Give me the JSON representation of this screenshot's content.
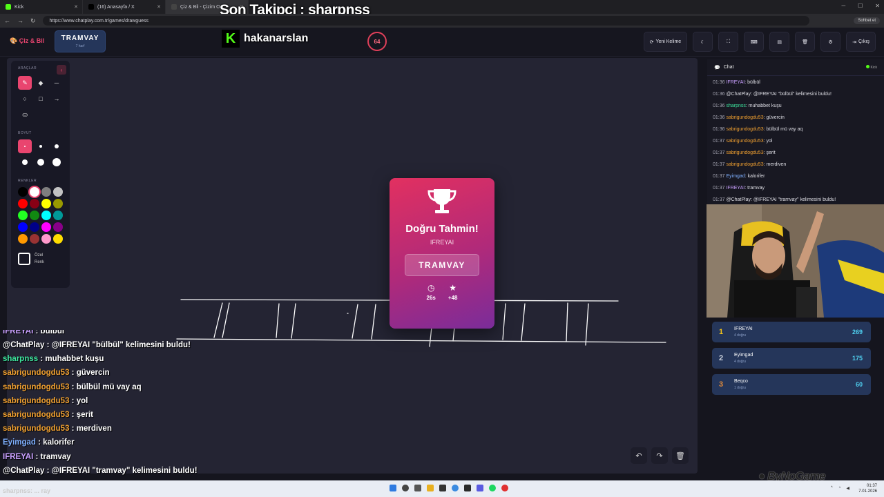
{
  "browser": {
    "tabs": [
      {
        "label": "Kick",
        "icon": "kick-icon",
        "active": false
      },
      {
        "label": "(16) Anasayfa / X",
        "icon": "x-icon",
        "active": false
      },
      {
        "label": "Çiz & Bil - Çizim O...",
        "icon": "chatplay-icon",
        "active": true
      }
    ],
    "url": "https://www.chatplay.com.tr/games/drawguess",
    "chat_button": "Sohbet et"
  },
  "overlay": {
    "follower_banner": "Son Takipçi : sharpnss",
    "kick_channel": "hakanarslan",
    "watermark": "ByNoGame"
  },
  "header": {
    "brand": "Çiz & Bil",
    "word": "TRAMVAY",
    "word_hint": "7 harf",
    "timer": "64",
    "buttons": {
      "new_word": "Yeni Kelime",
      "exit": "Çıkış"
    }
  },
  "tools": {
    "tools_title": "ARAÇLAR",
    "size_title": "BOYUT",
    "colors_title": "RENKLER",
    "custom_color": "Özel Renk",
    "palette": [
      "#000000",
      "#ffffff",
      "#7f7f7f",
      "#c3c3c3",
      "#ff0000",
      "#880015",
      "#ffff00",
      "#999900",
      "#22ff22",
      "#118811",
      "#00ffff",
      "#009999",
      "#0000ff",
      "#000088",
      "#ff00ff",
      "#880088",
      "#ff9900",
      "#993333",
      "#ff99cc",
      "#ffdd00"
    ]
  },
  "result": {
    "title": "Doğru Tahmin!",
    "winner": "IFREYAI",
    "word": "TRAMVAY",
    "time": "26s",
    "points": "+48"
  },
  "overlay_chat": [
    {
      "user": "IFREYAI",
      "color": "#c9a0ff",
      "msg": "bülbül",
      "cut": true
    },
    {
      "user": "@ChatPlay",
      "color": "#ffffff",
      "msg": "@IFREYAI \"bülbül\" kelimesini buldu!"
    },
    {
      "user": "sharpnss",
      "color": "#3ee8a0",
      "msg": "muhabbet kuşu"
    },
    {
      "user": "sabrigundogdu53",
      "color": "#f0a030",
      "msg": "güvercin"
    },
    {
      "user": "sabrigundogdu53",
      "color": "#f0a030",
      "msg": "bülbül mü vay aq"
    },
    {
      "user": "sabrigundogdu53",
      "color": "#f0a030",
      "msg": "yol"
    },
    {
      "user": "sabrigundogdu53",
      "color": "#f0a030",
      "msg": "şerit"
    },
    {
      "user": "sabrigundogdu53",
      "color": "#f0a030",
      "msg": "merdiven"
    },
    {
      "user": "Eyimgad",
      "color": "#7fb0ff",
      "msg": "kalorifer"
    },
    {
      "user": "IFREYAI",
      "color": "#c9a0ff",
      "msg": "tramvay"
    },
    {
      "user": "@ChatPlay",
      "color": "#ffffff",
      "msg": "@IFREYAI \"tramvay\" kelimesini buldu!"
    }
  ],
  "chat": {
    "title": "Chat",
    "source": "Kick",
    "messages": [
      {
        "time": "01:36",
        "user": "IFREYAI",
        "color": "#c9a0ff",
        "msg": ": bülbül"
      },
      {
        "time": "01:36",
        "user": "@ChatPlay",
        "color": "#dfdfe6",
        "msg": ": @IFREYAI \"bülbül\" kelimesini buldu!"
      },
      {
        "time": "01:36",
        "user": "sharpnss",
        "color": "#3ee8a0",
        "msg": ": muhabbet kuşu"
      },
      {
        "time": "01:36",
        "user": "sabrigundogdu53",
        "color": "#f0a030",
        "msg": ": güvercin"
      },
      {
        "time": "01:36",
        "user": "sabrigundogdu53",
        "color": "#f0a030",
        "msg": ": bülbül mü vay aq"
      },
      {
        "time": "01:37",
        "user": "sabrigundogdu53",
        "color": "#f0a030",
        "msg": ": yol"
      },
      {
        "time": "01:37",
        "user": "sabrigundogdu53",
        "color": "#f0a030",
        "msg": ": şerit"
      },
      {
        "time": "01:37",
        "user": "sabrigundogdu53",
        "color": "#f0a030",
        "msg": ": merdiven"
      },
      {
        "time": "01:37",
        "user": "Eyimgad",
        "color": "#7fb0ff",
        "msg": ": kalorifer"
      },
      {
        "time": "01:37",
        "user": "IFREYAI",
        "color": "#c9a0ff",
        "msg": ": tramvay"
      },
      {
        "time": "01:37",
        "user": "@ChatPlay",
        "color": "#dfdfe6",
        "msg": ": @IFREYAI \"tramvay\" kelimesini buldu!"
      }
    ]
  },
  "leaderboard": [
    {
      "rank": "1",
      "name": "IFREYAI",
      "sub": "4 doğru",
      "score": "269",
      "rank_color": "#f5c518"
    },
    {
      "rank": "2",
      "name": "Eyimgad",
      "sub": "4 doğru",
      "score": "175",
      "rank_color": "#d0d6e0"
    },
    {
      "rank": "3",
      "name": "Beqco",
      "sub": "1 doğru",
      "score": "60",
      "rank_color": "#e08a3a"
    }
  ],
  "taskbar": {
    "time": "01:37",
    "date": "7.01.2026",
    "tray_text": "sharpnss: ... ray"
  }
}
